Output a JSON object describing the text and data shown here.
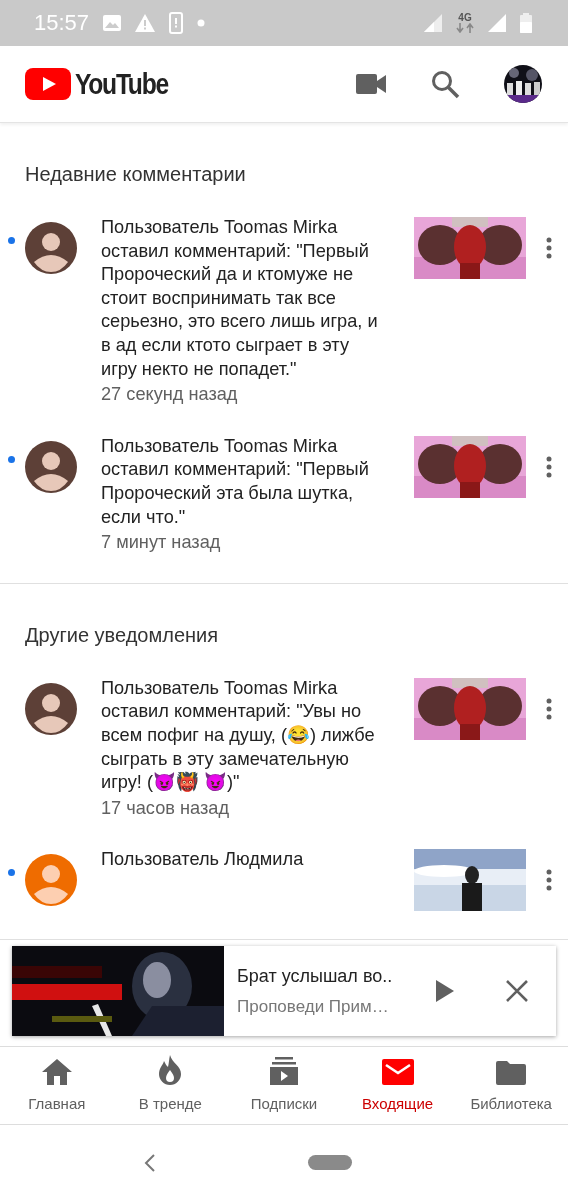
{
  "status_bar": {
    "time": "15:57",
    "network": "4G"
  },
  "header": {
    "logo": "YouTube"
  },
  "sections": [
    {
      "title": "Недавние комментарии",
      "items": [
        {
          "text": "Пользователь Toomas Mirka оставил комментарий: \"Первый Пророческий да и ктомуже не стоит воспринимать так все серьезно, это всего лишь игра, и в ад если ктото сыграет в эту игру некто не попадет.\"",
          "time": "27 секунд назад",
          "unread": true,
          "color": "#5d4037"
        },
        {
          "text": "Пользователь Toomas Mirka оставил комментарий: \"Первый Пророческий эта была шутка, если что.\"",
          "time": "7 минут назад",
          "unread": true,
          "color": "#5d4037"
        }
      ]
    },
    {
      "title": "Другие уведомления",
      "items": [
        {
          "text": "Пользователь Toomas Mirka оставил комментарий: \"Увы но всем пофиг на душу, (😂) лижбе сыграть в эту замечательную игру! (😈👹 😈)\"",
          "time": "17 часов назад",
          "unread": false,
          "color": "#5d4037"
        },
        {
          "text": "Пользователь Людмила",
          "unread": true,
          "color": "#ef6c00"
        }
      ]
    }
  ],
  "miniplayer": {
    "title": "Брат услышал во..",
    "channel": "Проповеди Прим…"
  },
  "nav": [
    {
      "kind": "home",
      "label": "Главная",
      "selected": false
    },
    {
      "kind": "trending",
      "label": "В тренде",
      "selected": false
    },
    {
      "kind": "subscriptions",
      "label": "Подписки",
      "selected": false
    },
    {
      "kind": "inbox",
      "label": "Входящие",
      "selected": true
    },
    {
      "kind": "library",
      "label": "Библиотека",
      "selected": false
    }
  ]
}
